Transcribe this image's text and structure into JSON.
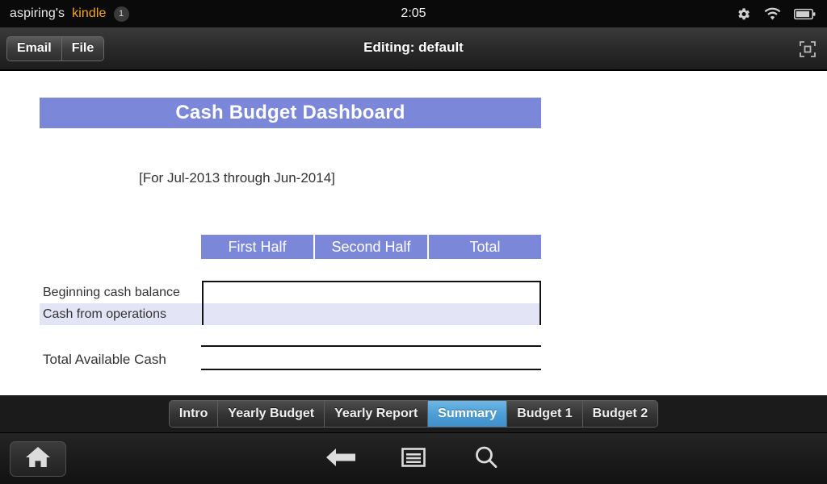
{
  "status_bar": {
    "owner_label": "aspiring's",
    "brand_label": "kindle",
    "notification_count": "1",
    "clock": "2:05",
    "icons": [
      "gear-icon",
      "wifi-icon",
      "battery-icon"
    ]
  },
  "toolbar": {
    "email_label": "Email",
    "file_label": "File",
    "title": "Editing: default",
    "fullscreen_icon": "fullscreen-icon"
  },
  "document": {
    "banner_title": "Cash Budget Dashboard",
    "period_label": "[For Jul-2013 through Jun-2014]",
    "column_headers": [
      "First Half",
      "Second Half",
      "Total"
    ],
    "rows": [
      {
        "label": "Beginning cash balance",
        "first_half": "",
        "second_half": "",
        "total": ""
      },
      {
        "label": "Cash from operations",
        "first_half": "",
        "second_half": "",
        "total": ""
      }
    ],
    "total_row": {
      "label": "Total Available Cash",
      "first_half": "",
      "second_half": "",
      "total": ""
    }
  },
  "sheet_tabs": {
    "items": [
      {
        "label": "Intro",
        "active": false
      },
      {
        "label": "Yearly Budget",
        "active": false
      },
      {
        "label": "Yearly Report",
        "active": false
      },
      {
        "label": "Summary",
        "active": true
      },
      {
        "label": "Budget 1",
        "active": false
      },
      {
        "label": "Budget 2",
        "active": false
      }
    ]
  },
  "nav_bar": {
    "home_icon": "home-icon",
    "back_icon": "back-arrow-icon",
    "menu_icon": "menu-icon",
    "search_icon": "search-icon"
  },
  "colors": {
    "accent": "#7b87d8",
    "row_alt": "#e4e4f7",
    "active_tab": "#4d9ed6",
    "brand_orange": "#f5a623"
  }
}
